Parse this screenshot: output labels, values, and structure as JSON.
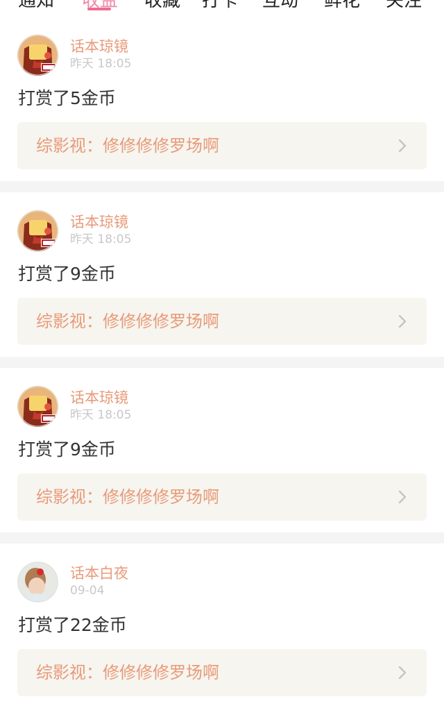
{
  "tabs": [
    {
      "label": "通知"
    },
    {
      "label": "收益"
    },
    {
      "label": "收藏"
    },
    {
      "label": "打卡"
    },
    {
      "label": "互动"
    },
    {
      "label": "鲜花"
    },
    {
      "label": "关注"
    }
  ],
  "active_tab": "收益",
  "colors": {
    "accent_pink": "#ee6b94",
    "name_orange": "#e99a79",
    "link_bg": "#f6f5ef",
    "divider_gray": "#f5f4f4"
  },
  "feed": [
    {
      "avatar": "book-cover-avatar",
      "username": "话本琼镜",
      "time": "昨天 18:05",
      "message": "打赏了5金币",
      "link": "综影视：修修修修罗场啊"
    },
    {
      "avatar": "book-cover-avatar",
      "username": "话本琼镜",
      "time": "昨天 18:05",
      "message": "打赏了9金币",
      "link": "综影视：修修修修罗场啊"
    },
    {
      "avatar": "book-cover-avatar",
      "username": "话本琼镜",
      "time": "昨天 18:05",
      "message": "打赏了9金币",
      "link": "综影视：修修修修罗场啊"
    },
    {
      "avatar": "photo-avatar",
      "username": "话本白夜",
      "time": "09-04",
      "message": "打赏了22金币",
      "link": "综影视：修修修修罗场啊"
    }
  ]
}
